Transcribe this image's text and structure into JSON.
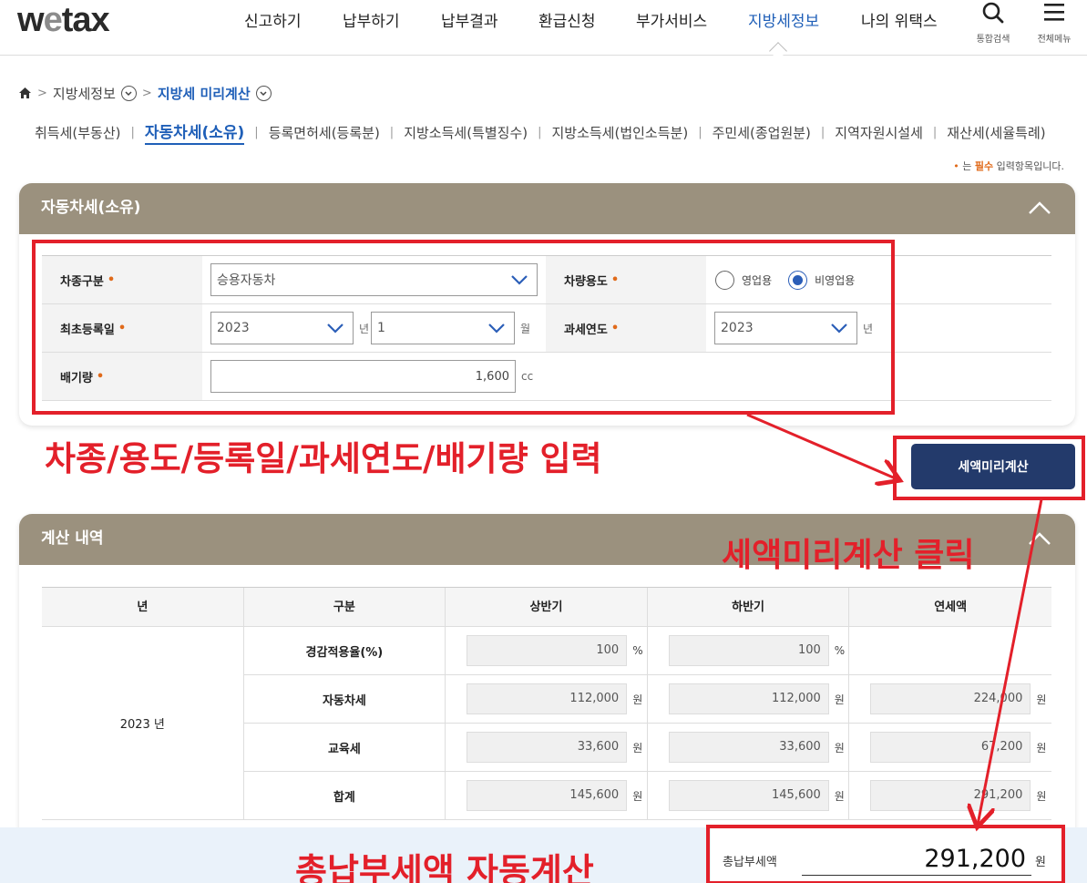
{
  "header": {
    "logo": {
      "w": "w",
      "e": "e",
      "rest": "tax"
    },
    "nav": [
      "신고하기",
      "납부하기",
      "납부결과",
      "환급신청",
      "부가서비스",
      "지방세정보",
      "나의 위택스"
    ],
    "active_nav": "지방세정보",
    "search_label": "통합검색",
    "menu_label": "전체메뉴"
  },
  "breadcrumb": {
    "level1": "지방세정보",
    "level2": "지방세 미리계산"
  },
  "tax_tabs": [
    "취득세(부동산)",
    "자동차세(소유)",
    "등록면허세(등록분)",
    "지방소득세(특별징수)",
    "지방소득세(법인소득분)",
    "주민세(종업원분)",
    "지역자원시설세",
    "재산세(세율특례)"
  ],
  "active_tab": "자동차세(소유)",
  "required_note": {
    "prefix": "는",
    "required": "필수",
    "suffix": "입력항목입니다."
  },
  "input_panel": {
    "title": "자동차세(소유)",
    "vehicle_type": {
      "label": "차종구분",
      "value": "승용자동차"
    },
    "vehicle_use": {
      "label": "차량용도",
      "options": [
        "영업용",
        "비영업용"
      ],
      "selected": "비영업용"
    },
    "first_registration": {
      "label": "최초등록일",
      "year": "2023",
      "year_unit": "년",
      "month": "1",
      "month_unit": "월"
    },
    "tax_year": {
      "label": "과세연도",
      "value": "2023",
      "unit": "년"
    },
    "displacement": {
      "label": "배기량",
      "value": "1,600",
      "unit": "cc"
    }
  },
  "calc_button": "세액미리계산",
  "result_panel": {
    "title": "계산 내역",
    "headers": [
      "년",
      "구분",
      "상반기",
      "하반기",
      "연세액"
    ],
    "year": "2023 년",
    "rows": [
      {
        "label": "경감적용율(%)",
        "first_half": "100",
        "second_half": "100",
        "annual": "",
        "unit": "%"
      },
      {
        "label": "자동차세",
        "first_half": "112,000",
        "second_half": "112,000",
        "annual": "224,000",
        "unit": "원"
      },
      {
        "label": "교육세",
        "first_half": "33,600",
        "second_half": "33,600",
        "annual": "67,200",
        "unit": "원"
      },
      {
        "label": "합계",
        "first_half": "145,600",
        "second_half": "145,600",
        "annual": "291,200",
        "unit": "원"
      }
    ],
    "total": {
      "label": "총납부세액",
      "value": "291,200",
      "unit": "원"
    }
  },
  "annotations": {
    "input_note": "차종/용도/등록일/과세연도/배기량 입력",
    "click_note": "세액미리계산 클릭",
    "auto_note": "총납부세액 자동계산",
    "color": "#e3202a"
  }
}
